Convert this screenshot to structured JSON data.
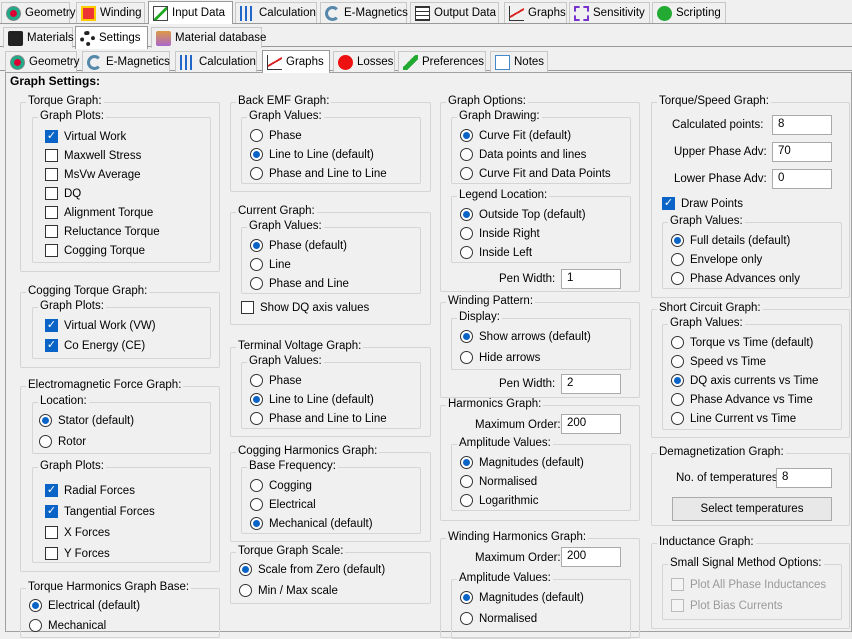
{
  "top_tabs": [
    "Geometry",
    "Winding",
    "Input Data",
    "Calculation",
    "E-Magnetics",
    "Output Data",
    "Graphs",
    "Sensitivity",
    "Scripting"
  ],
  "second_tabs": [
    "Materials",
    "Settings",
    "Material database"
  ],
  "third_tabs": [
    "Geometry",
    "E-Magnetics",
    "Calculation",
    "Graphs",
    "Losses",
    "Preferences",
    "Notes"
  ],
  "title": "Graph Settings:",
  "torque_graph": {
    "label": "Torque Graph:",
    "plots_label": "Graph Plots:",
    "items": [
      "Virtual Work",
      "Maxwell Stress",
      "MsVw Average",
      "DQ",
      "Alignment Torque",
      "Reluctance Torque",
      "Cogging Torque"
    ],
    "checked": [
      true,
      false,
      false,
      false,
      false,
      false,
      false
    ]
  },
  "cogging_torque_graph": {
    "label": "Cogging Torque Graph:",
    "plots_label": "Graph Plots:",
    "items": [
      "Virtual Work (VW)",
      "Co Energy (CE)"
    ]
  },
  "em_force": {
    "label": "Electromagnetic Force Graph:",
    "location_label": "Location:",
    "locations": [
      "Stator (default)",
      "Rotor"
    ],
    "plots_label": "Graph Plots:",
    "plots": [
      "Radial Forces",
      "Tangential Forces",
      "X Forces",
      "Y Forces"
    ]
  },
  "torque_harm_base": {
    "label": "Torque Harmonics Graph Base:",
    "items": [
      "Electrical (default)",
      "Mechanical"
    ]
  },
  "back_emf": {
    "label": "Back EMF Graph:",
    "values_label": "Graph Values:",
    "items": [
      "Phase",
      "Line to Line (default)",
      "Phase and Line to Line"
    ]
  },
  "current_graph": {
    "label": "Current Graph:",
    "values_label": "Graph Values:",
    "items": [
      "Phase (default)",
      "Line",
      "Phase and Line"
    ],
    "dq": "Show DQ axis values"
  },
  "terminal_voltage": {
    "label": "Terminal Voltage Graph:",
    "values_label": "Graph Values:",
    "items": [
      "Phase",
      "Line to Line (default)",
      "Phase and Line to Line"
    ]
  },
  "cogging_harmonics": {
    "label": "Cogging Harmonics Graph:",
    "base_label": "Base Frequency:",
    "items": [
      "Cogging",
      "Electrical",
      "Mechanical (default)"
    ]
  },
  "torque_scale": {
    "label": "Torque Graph Scale:",
    "items": [
      "Scale from Zero (default)",
      "Min / Max scale"
    ]
  },
  "graph_options": {
    "label": "Graph Options:",
    "drawing_label": "Graph Drawing:",
    "drawing": [
      "Curve Fit (default)",
      "Data points and lines",
      "Curve Fit and Data Points"
    ],
    "legend_label": "Legend Location:",
    "legend": [
      "Outside Top (default)",
      "Inside Right",
      "Inside Left"
    ],
    "pen_label": "Pen Width:",
    "pen": "1"
  },
  "winding_pattern": {
    "label": "Winding Pattern:",
    "display_label": "Display:",
    "items": [
      "Show arrows (default)",
      "Hide arrows"
    ],
    "pen_label": "Pen Width:",
    "pen": "2"
  },
  "harmonics": {
    "label": "Harmonics Graph:",
    "order_label": "Maximum Order:",
    "order": "200",
    "amp_label": "Amplitude Values:",
    "items": [
      "Magnitudes (default)",
      "Normalised",
      "Logarithmic"
    ]
  },
  "winding_harmonics": {
    "label": "Winding Harmonics Graph:",
    "order_label": "Maximum Order:",
    "order": "200",
    "amp_label": "Amplitude Values:",
    "items": [
      "Magnitudes (default)",
      "Normalised"
    ]
  },
  "torque_speed": {
    "label": "Torque/Speed Graph:",
    "calc_label": "Calculated points:",
    "calc": "8",
    "upper_label": "Upper Phase Adv:",
    "upper": "70",
    "lower_label": "Lower Phase Adv:",
    "lower": "0",
    "draw_points": "Draw Points",
    "values_label": "Graph Values:",
    "items": [
      "Full details (default)",
      "Envelope only",
      "Phase Advances only"
    ]
  },
  "short_circuit": {
    "label": "Short Circuit Graph:",
    "values_label": "Graph Values:",
    "items": [
      "Torque vs Time (default)",
      "Speed vs Time",
      "DQ axis currents vs Time",
      "Phase Advance vs Time",
      "Line Current vs Time"
    ]
  },
  "demag": {
    "label": "Demagnetization Graph:",
    "temps_label": "No. of temperatures:",
    "temps": "8",
    "button": "Select temperatures"
  },
  "inductance": {
    "label": "Inductance Graph:",
    "method_label": "Small Signal Method Options:",
    "items": [
      "Plot All Phase Inductances",
      "Plot Bias Currents"
    ]
  }
}
